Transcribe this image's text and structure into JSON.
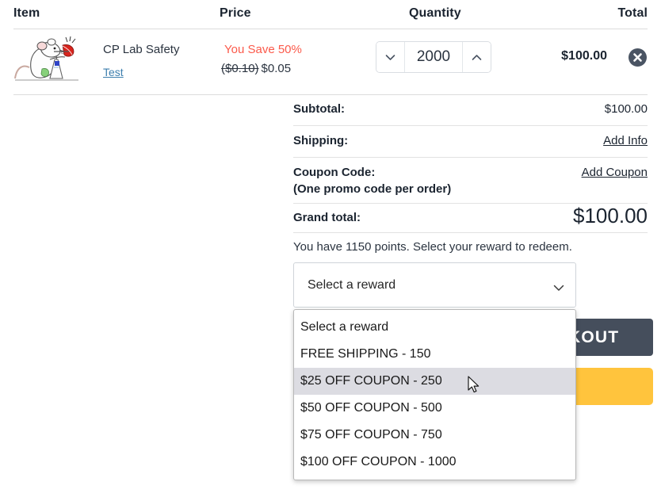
{
  "table": {
    "headers": {
      "item": "Item",
      "price": "Price",
      "quantity": "Quantity",
      "total": "Total"
    },
    "row": {
      "product_name": "CP Lab Safety",
      "product_link": "Test",
      "save_text": "You Save 50%",
      "price_old": "($0.10)",
      "price_new": "$0.05",
      "quantity": "2000",
      "line_total": "$100.00",
      "thumb_alt": "cartoon lab mouse illustration"
    }
  },
  "summary": {
    "subtotal_label": "Subtotal:",
    "subtotal_value": "$100.00",
    "shipping_label": "Shipping:",
    "shipping_link": "Add Info",
    "coupon_label": "Coupon Code:",
    "coupon_sub": "(One promo code per order)",
    "coupon_link": "Add Coupon",
    "grand_label": "Grand total:",
    "grand_value": "$100.00",
    "points_note": "You have 1150 points. Select your reward to redeem."
  },
  "reward_select": {
    "value": "Select a reward",
    "expanded": true,
    "options": [
      "Select a reward",
      "FREE SHIPPING - 150",
      "$25 OFF COUPON - 250",
      "$50 OFF COUPON - 500",
      "$75 OFF COUPON - 750",
      "$100 OFF COUPON - 1000"
    ],
    "highlighted_index": 2
  },
  "actions": {
    "checkout_label": "CHECKOUT",
    "checkout_visible_text": "KOUT",
    "paypal_label": ""
  },
  "colors": {
    "accent_red": "#fb5a4b",
    "link_blue": "#3e7fae",
    "checkout_dark": "#454e5c",
    "paypal_yellow": "#ffc43d",
    "option_highlight": "#dcdce2"
  }
}
